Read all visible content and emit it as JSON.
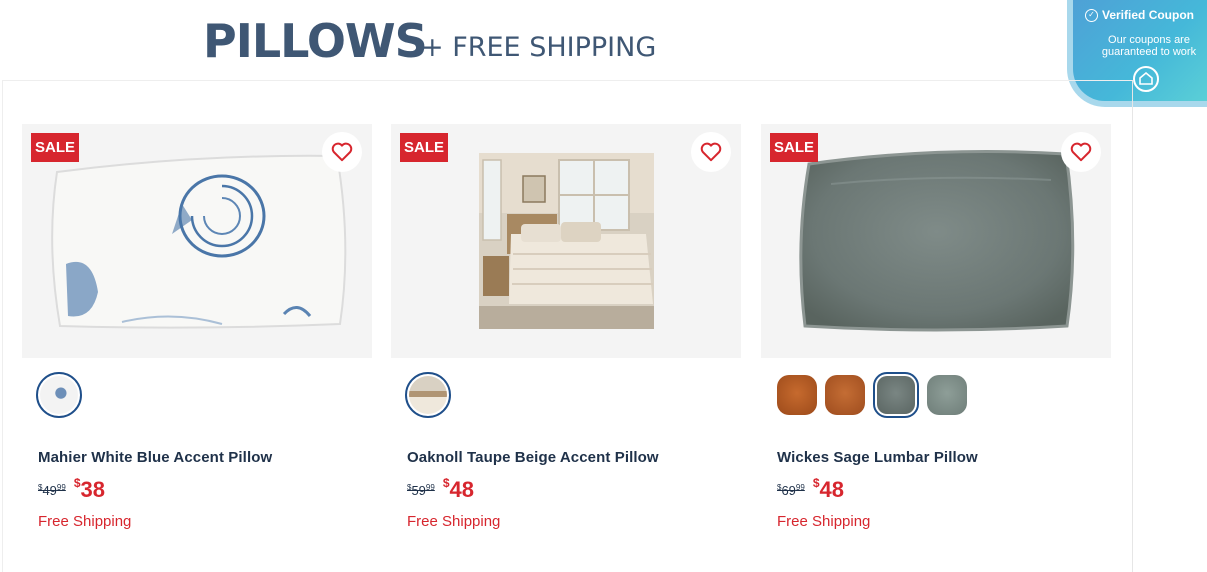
{
  "header": {
    "title": "PILLOWS",
    "subtitle": "+ FREE SHIPPING"
  },
  "coupon": {
    "heading": "Verified Coupon",
    "text": "Our coupons are guaranteed to work",
    "icon": "coupon-tag-icon"
  },
  "products": [
    {
      "badge": "SALE",
      "name": "Mahier White Blue Accent Pillow",
      "was_dollars": "49",
      "was_cents": "99",
      "now_symbol": "$",
      "now_dollars": "38",
      "shipping": "Free Shipping",
      "swatches": [
        "white-blue-seashell"
      ]
    },
    {
      "badge": "SALE",
      "name": "Oaknoll Taupe Beige Accent Pillow",
      "was_dollars": "59",
      "was_cents": "99",
      "now_symbol": "$",
      "now_dollars": "48",
      "shipping": "Free Shipping",
      "swatches": [
        "bedroom-scene"
      ]
    },
    {
      "badge": "SALE",
      "name": "Wickes Sage Lumbar Pillow",
      "was_dollars": "69",
      "was_cents": "99",
      "now_symbol": "$",
      "now_dollars": "48",
      "shipping": "Free Shipping",
      "swatches": [
        "rust",
        "rust",
        "sage-selected",
        "sage-light"
      ]
    }
  ],
  "colors": {
    "accent_red": "#d7262e",
    "title_blue": "#3f5774",
    "text_navy": "#1f3149",
    "coupon_teal": "#45b8d9"
  }
}
